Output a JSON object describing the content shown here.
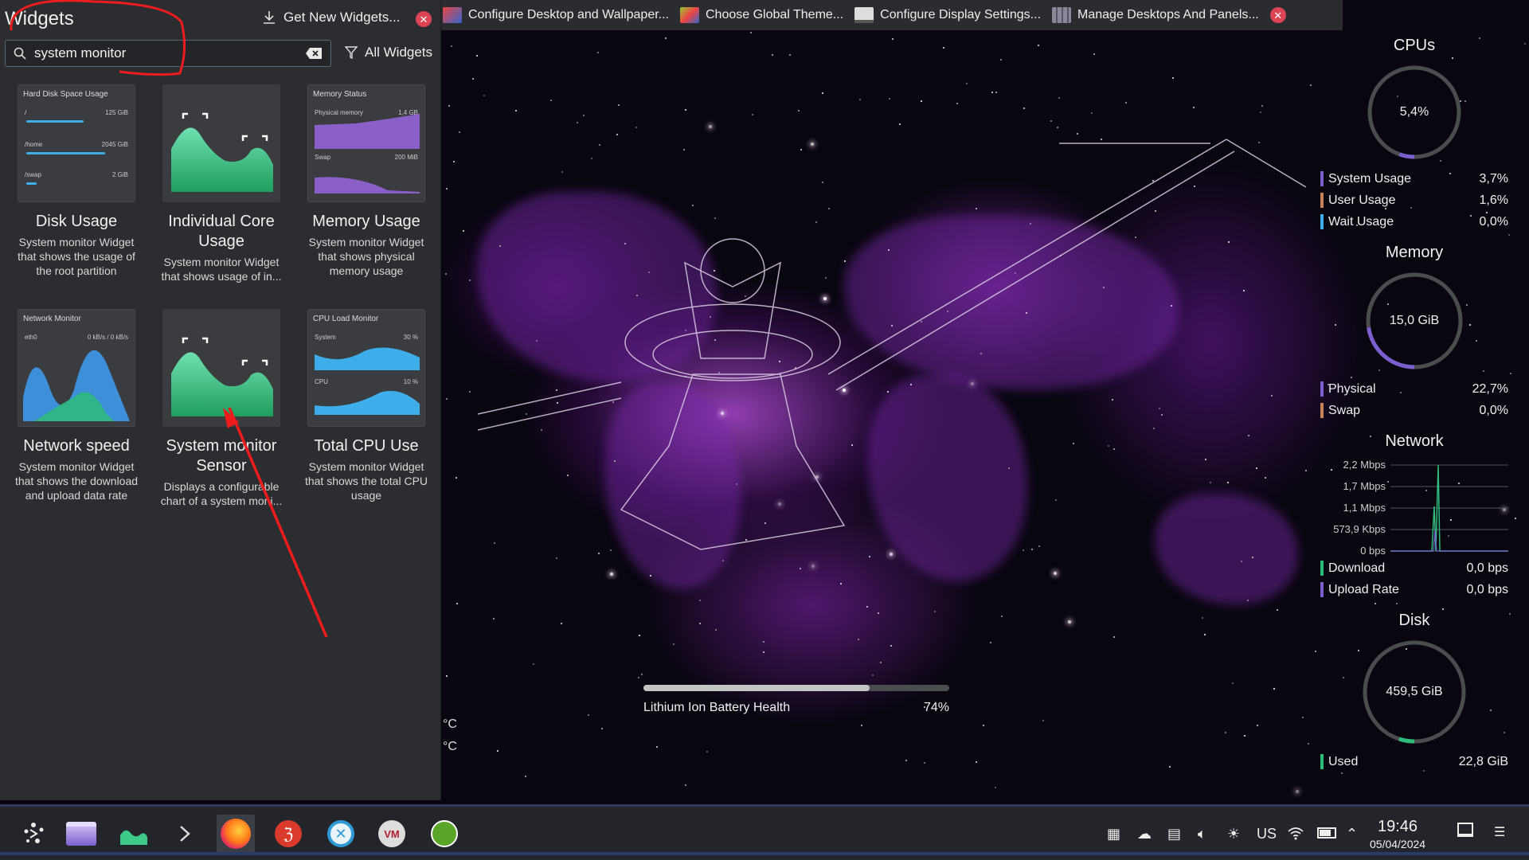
{
  "topbar": {
    "items": [
      {
        "label": "Configure Desktop and Wallpaper...",
        "color": "#e44"
      },
      {
        "label": "Choose Global Theme...",
        "color": "#9c3"
      },
      {
        "label": "Configure Display Settings...",
        "color": "#ddd"
      },
      {
        "label": "Manage Desktops And Panels...",
        "color": "#889"
      }
    ],
    "close_icon": "close-icon"
  },
  "widgets_panel": {
    "title": "Widgets",
    "get_new_label": "Get New Widgets...",
    "search": {
      "value": "system monitor",
      "placeholder": "Search..."
    },
    "filter_label": "All Widgets",
    "cards": [
      {
        "name": "Disk Usage",
        "desc": "System monitor Widget that shows the usage of the root partition",
        "thumb": {
          "title": "Hard Disk Space Usage",
          "rows": [
            {
              "label": "/",
              "value": "125 GiB",
              "fill": 0.65
            },
            {
              "label": "/home",
              "value": "2045 GiB",
              "fill": 0.9
            },
            {
              "label": "/swap",
              "value": "2 GiB",
              "fill": 0.12
            }
          ]
        }
      },
      {
        "name": "Individual Core Usage",
        "desc": "System monitor Widget that shows usage of in..."
      },
      {
        "name": "Memory Usage",
        "desc": "System monitor Widget that shows physical memory usage",
        "thumb": {
          "title": "Memory Status",
          "physical_label": "Physical memory",
          "physical_value": "1,4 GB",
          "swap_label": "Swap",
          "swap_value": "200 MiB"
        }
      },
      {
        "name": "Network speed",
        "desc": "System monitor Widget that shows the download and upload data rate",
        "thumb": {
          "title": "Network Monitor",
          "iface": "eth0",
          "rate": "0 kB/s / 0 kB/s"
        }
      },
      {
        "name": "System monitor Sensor",
        "desc": "Displays a configurable chart of a system moni..."
      },
      {
        "name": "Total CPU Use",
        "desc": "System monitor Widget that shows the total CPU usage",
        "thumb": {
          "title": "CPU Load Monitor",
          "system_label": "System",
          "system_value": "30 %",
          "cpu_label": "CPU",
          "cpu_value": "10 %"
        }
      }
    ]
  },
  "sysmon": {
    "cpus": {
      "title": "CPUs",
      "gauge_value": "5,4%",
      "fraction": 0.054,
      "rows": [
        {
          "label": "System Usage",
          "value": "3,7%",
          "color": "#7b5fd1"
        },
        {
          "label": "User Usage",
          "value": "1,6%",
          "color": "#c8825a"
        },
        {
          "label": "Wait Usage",
          "value": "0,0%",
          "color": "#3daee9"
        }
      ]
    },
    "memory": {
      "title": "Memory",
      "gauge_value": "15,0 GiB",
      "fraction": 0.227,
      "rows": [
        {
          "label": "Physical",
          "value": "22,7%",
          "color": "#7b5fd1"
        },
        {
          "label": "Swap",
          "value": "0,0%",
          "color": "#c8825a"
        }
      ]
    },
    "network": {
      "title": "Network",
      "ticks": [
        "2,2 Mbps",
        "1,7 Mbps",
        "1,1 Mbps",
        "573,9 Kbps",
        "0 bps"
      ],
      "rows": [
        {
          "label": "Download",
          "value": "0,0 bps",
          "color": "#2ebc7c"
        },
        {
          "label": "Upload Rate",
          "value": "0,0 bps",
          "color": "#7b5fd1"
        }
      ]
    },
    "disk": {
      "title": "Disk",
      "gauge_value": "459,5 GiB",
      "fraction": 0.05,
      "rows": [
        {
          "label": "Used",
          "value": "22,8 GiB",
          "color": "#2ebc7c"
        }
      ]
    }
  },
  "battery": {
    "label": "Lithium Ion Battery Health",
    "value": "74%",
    "fraction": 0.74
  },
  "temp_units": [
    "°C",
    "°C"
  ],
  "taskbar": {
    "apps": [
      "app-launcher-icon",
      "dolphin-icon",
      "system-monitor-icon",
      "terminal-icon",
      "firefox-icon",
      "app-red-icon",
      "app-blue-icon",
      "app-vm-icon",
      "app-green-icon"
    ],
    "tray": {
      "keyboard_layout": "US"
    },
    "clock": {
      "time": "19:46",
      "date": "05/04/2024"
    }
  }
}
